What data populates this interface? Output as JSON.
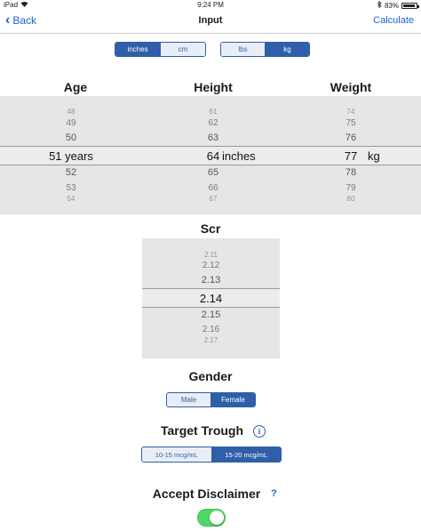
{
  "status": {
    "device": "iPad",
    "time": "9:24 PM",
    "battery": "83%",
    "battery_level": 0.83
  },
  "nav": {
    "back_label": "Back",
    "title": "Input",
    "action_label": "Calculate"
  },
  "height_unit": {
    "options": [
      "inches",
      "cm"
    ],
    "selected": "inches"
  },
  "weight_unit": {
    "options": [
      "lbs",
      "kg"
    ],
    "selected": "kg"
  },
  "age": {
    "heading": "Age",
    "above": [
      "48",
      "49",
      "50"
    ],
    "selected": "51 years",
    "below": [
      "52",
      "53",
      "54"
    ]
  },
  "height": {
    "heading": "Height",
    "above": [
      "61",
      "62",
      "63"
    ],
    "selected": "64",
    "unit": "inches",
    "below": [
      "65",
      "66",
      "67"
    ]
  },
  "weight": {
    "heading": "Weight",
    "above": [
      "74",
      "75",
      "76"
    ],
    "selected": "77",
    "unit": "kg",
    "below": [
      "78",
      "79",
      "80"
    ]
  },
  "scr": {
    "heading": "Scr",
    "above": [
      "2.11",
      "2.12",
      "2.13"
    ],
    "selected": "2.14",
    "below": [
      "2.15",
      "2.16",
      "2.17"
    ]
  },
  "gender": {
    "heading": "Gender",
    "options": [
      "Male",
      "Female"
    ],
    "selected": "Female"
  },
  "target_trough": {
    "heading": "Target Trough",
    "options": [
      "10-15 mcg/mL",
      "15-20 mcg/mL"
    ],
    "selected": "15-20 mcg/mL"
  },
  "disclaimer": {
    "heading": "Accept Disclaimer",
    "help": "?",
    "accepted": true
  },
  "colors": {
    "accent": "#2f5fa8",
    "link": "#1a63d1",
    "toggle_on": "#4cd964"
  }
}
